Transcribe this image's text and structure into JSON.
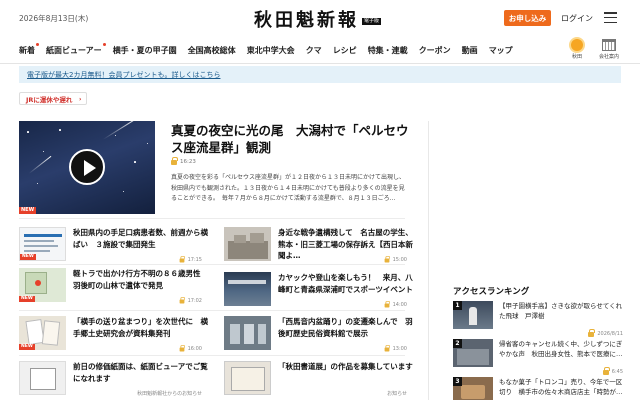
{
  "header": {
    "date": "2026年8月13日(木)",
    "logo": "秋田魁新報",
    "logo_badge": "電子版",
    "apply_label": "お申し込み",
    "login_label": "ログイン"
  },
  "nav": {
    "items": [
      "新着",
      "紙面ビューアー",
      "横手・夏の甲子園",
      "全国高校総体",
      "東北中学大会",
      "クマ",
      "レシピ",
      "特集・連載",
      "クーポン",
      "動画",
      "マップ"
    ],
    "weather_label": "秋田",
    "company_label": "会社案内"
  },
  "promo": {
    "text": "電子版が最大2カ月無料！会員プレゼントも。詳しくはこちら"
  },
  "tag": {
    "label": "JRに運休や遅れ"
  },
  "feature": {
    "title": "真夏の夜空に光の尾　大潟村で「ペルセウス座流星群」観測",
    "time": "16:23",
    "body": "真夏の夜空を彩る「ペルセウス座流星群」が１２日夜から１３日未明にかけて出現し、秋田県内でも観測された。１３日夜から１４日未明にかけても普段より多くの流星を見ることができる。　毎年７月から８月にかけて活動する流星群で、８月１３日ごろ…",
    "new_label": "NEW"
  },
  "articles": [
    {
      "title": "秋田県内の手足口病患者数、前週から横ばい　３施設で集団発生",
      "meta": "17:15",
      "new": "NEW"
    },
    {
      "title": "身近な戦争遺構残して　名古屋の学生、熊本・旧三菱工場の保存訴え【西日本新聞よ…",
      "meta": "15:00",
      "new": ""
    },
    {
      "title": "軽トラで出かけ行方不明の８６歳男性　羽後町の山林で遺体で発見",
      "meta": "17:02",
      "new": "NEW"
    },
    {
      "title": "カヤックや登山を楽しもう！　来月、八峰町と青森県深浦町でスポーツイベント",
      "meta": "14:00",
      "new": ""
    },
    {
      "title": "「横手の送り盆まつり」を次世代に　横手郷土史研究会が資料集発刊",
      "meta": "16:00",
      "new": "NEW"
    },
    {
      "title": "「西馬音内盆踊り」の変遷楽しんで　羽後町歴史民俗資料館で展示",
      "meta": "13:00",
      "new": ""
    },
    {
      "title": "前日の修価紙面は、紙面ビューアでご覧になれます",
      "meta": "秋田魁新報社からのお知らせ",
      "new": ""
    },
    {
      "title": "「秋田書道展」の作品を募集しています",
      "meta": "お知らせ",
      "new": ""
    }
  ],
  "ranking": {
    "title": "アクセスランキング",
    "items": [
      {
        "num": "1",
        "title": "【甲子園横手高】さきな欲が取らせてくれた飛球　戸澤樹",
        "meta": "2026/8/11"
      },
      {
        "num": "2",
        "title": "帰省客のキャンセル続く中、少しずつにぎやかな声　秋田出身女性、熊本で医療に…",
        "meta": "6:45"
      },
      {
        "num": "3",
        "title": "もなか菓子「トロンコ」売り、今年で一区切り　横手市の佐々木商店店主「時勢が…",
        "meta": ""
      }
    ]
  },
  "colors": {
    "accent": "#ee6a1c",
    "promo_bg": "#e4f1f9",
    "alert_red": "#d0302b"
  }
}
